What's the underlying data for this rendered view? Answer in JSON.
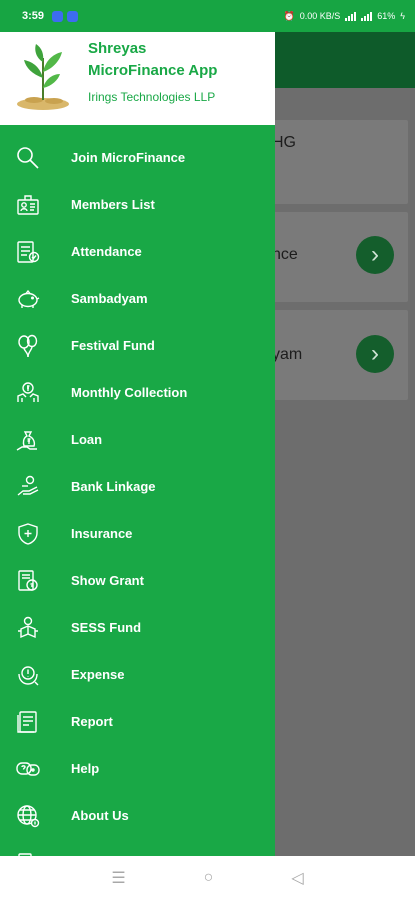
{
  "status_bar": {
    "time": "3:59",
    "right_text": "0.00 KB/S",
    "battery": "61%"
  },
  "background": {
    "card1": "HG",
    "card2": "nce",
    "card3": "yam"
  },
  "drawer": {
    "app_name_line1": "Shreyas",
    "app_name_line2": "MicroFinance App",
    "company": "Irings Technologies LLP",
    "items": [
      {
        "label": "Join MicroFinance",
        "icon": "search-icon"
      },
      {
        "label": "Members List",
        "icon": "members-list-icon"
      },
      {
        "label": "Attendance",
        "icon": "attendance-icon"
      },
      {
        "label": "Sambadyam",
        "icon": "piggy-bank-icon"
      },
      {
        "label": "Festival Fund",
        "icon": "balloons-icon"
      },
      {
        "label": "Monthly Collection",
        "icon": "collection-icon"
      },
      {
        "label": "Loan",
        "icon": "money-bag-icon"
      },
      {
        "label": "Bank Linkage",
        "icon": "hand-coin-icon"
      },
      {
        "label": "Insurance",
        "icon": "shield-icon"
      },
      {
        "label": "Show Grant",
        "icon": "grant-icon"
      },
      {
        "label": "SESS Fund",
        "icon": "fund-icon"
      },
      {
        "label": "Expense",
        "icon": "expense-icon"
      },
      {
        "label": "Report",
        "icon": "report-icon"
      },
      {
        "label": "Help",
        "icon": "help-icon"
      },
      {
        "label": "About Us",
        "icon": "globe-icon"
      }
    ]
  },
  "colors": {
    "drawer": "#19a846",
    "toolbar": "#0e5b2a",
    "scrim": "#6d6d6d"
  }
}
